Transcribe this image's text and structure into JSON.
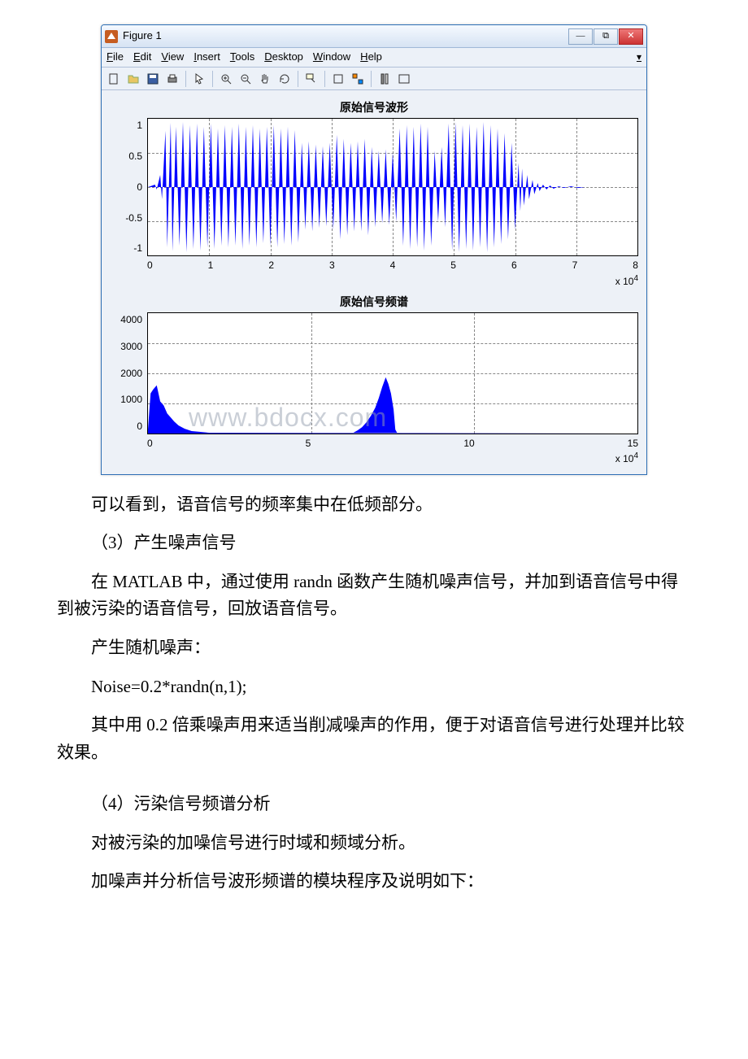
{
  "figure": {
    "window_title": "Figure 1",
    "menu": [
      "File",
      "Edit",
      "View",
      "Insert",
      "Tools",
      "Desktop",
      "Window",
      "Help"
    ],
    "titlebar_buttons": {
      "min": "—",
      "max": "⧉",
      "close": "✕"
    }
  },
  "chart_data": [
    {
      "type": "line",
      "title": "原始信号波形",
      "xlabel": "",
      "ylabel": "",
      "xlim": [
        0,
        80000
      ],
      "ylim": [
        -1,
        1
      ],
      "x_ticks": [
        "0",
        "1",
        "2",
        "3",
        "4",
        "5",
        "6",
        "7",
        "8"
      ],
      "y_ticks": [
        "1",
        "0.5",
        "0",
        "-0.5",
        "-1"
      ],
      "x_exponent": "x 10^4",
      "description": "Dense blue audio waveform, amplitude roughly ±1 for samples ~2000–60000, near-zero before ~2000 and decaying after ~60000."
    },
    {
      "type": "line",
      "title": "原始信号频谱",
      "xlabel": "",
      "ylabel": "",
      "xlim": [
        0,
        160000
      ],
      "ylim": [
        0,
        4000
      ],
      "x_ticks": [
        "0",
        "5",
        "10",
        "15"
      ],
      "y_ticks": [
        "4000",
        "3000",
        "2000",
        "1000",
        "0"
      ],
      "x_exponent": "x 10^4",
      "description": "Blue spectrum magnitude, large low-frequency lobe 0–~12000 peaking near 1500, near-zero mid-band, mirrored lobe ~68000–80000 peaking ~1700, then flat near zero to 160000."
    }
  ],
  "watermark": "www.bdocx.com",
  "body_text": {
    "p1": "可以看到，语音信号的频率集中在低频部分。",
    "p2": "（3）产生噪声信号",
    "p3": "在 MATLAB 中，通过使用 randn 函数产生随机噪声信号，并加到语音信号中得到被污染的语音信号，回放语音信号。",
    "p4": "产生随机噪声：",
    "code1": "Noise=0.2*randn(n,1);",
    "p5": "其中用 0.2 倍乘噪声用来适当削减噪声的作用，便于对语音信号进行处理并比较效果。",
    "p6": "（4）污染信号频谱分析",
    "p7": "对被污染的加噪信号进行时域和频域分析。",
    "p8": "加噪声并分析信号波形频谱的模块程序及说明如下："
  }
}
